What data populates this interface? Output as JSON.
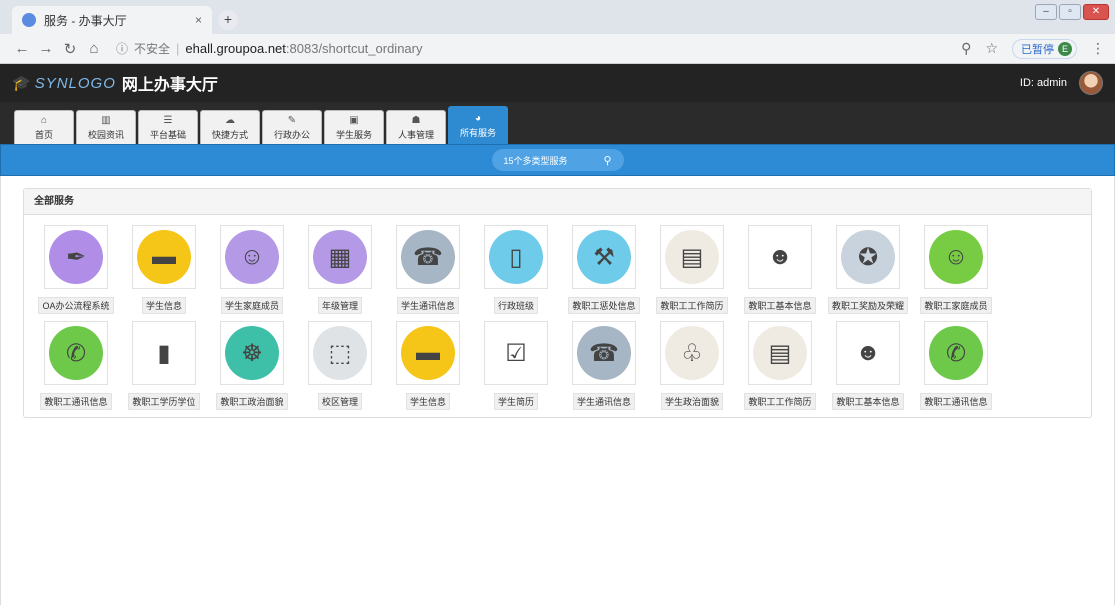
{
  "browser": {
    "tab_title": "服务 - 办事大厅",
    "tab_close": "×",
    "new_tab": "+",
    "insecure": "不安全",
    "url_host": "ehall.groupoa.net",
    "url_path": ":8083/shortcut_ordinary",
    "paused": "已暂停",
    "profile_initial": "E"
  },
  "header": {
    "logo_text": "SYNLOGO",
    "title": "网上办事大厅",
    "user": "ID: admin"
  },
  "nav": {
    "tabs": [
      {
        "label": "首页",
        "icon": "home-icon",
        "glyph": "⌂"
      },
      {
        "label": "校园资讯",
        "icon": "chart-icon",
        "glyph": "▥"
      },
      {
        "label": "平台基础",
        "icon": "list-icon",
        "glyph": "☰"
      },
      {
        "label": "快捷方式",
        "icon": "cloud-icon",
        "glyph": "☁"
      },
      {
        "label": "行政办公",
        "icon": "wrench-icon",
        "glyph": "✎"
      },
      {
        "label": "学生服务",
        "icon": "image-icon",
        "glyph": "▣"
      },
      {
        "label": "人事管理",
        "icon": "users-icon",
        "glyph": "☗"
      },
      {
        "label": "所有服务",
        "icon": "dashboard-icon",
        "glyph": "◕"
      }
    ]
  },
  "search": {
    "label": "15个多类型服务"
  },
  "panel": {
    "title": "全部服务"
  },
  "services": [
    {
      "label": "OA办公流程系统",
      "icon": "pen-icon",
      "color": "#b08ee8",
      "glyph": "✒"
    },
    {
      "label": "学生信息",
      "icon": "card-icon",
      "color": "#f5c518",
      "glyph": "▬"
    },
    {
      "label": "学生家庭成员",
      "icon": "astronaut-icon",
      "color": "#b49ae6",
      "glyph": "☺"
    },
    {
      "label": "年级管理",
      "icon": "building-icon",
      "color": "#b49ae6",
      "glyph": "▦"
    },
    {
      "label": "学生通讯信息",
      "icon": "phone-icon",
      "color": "#a6b6c4",
      "glyph": "☎"
    },
    {
      "label": "行政班级",
      "icon": "door-icon",
      "color": "#6fcbea",
      "glyph": "▯"
    },
    {
      "label": "教职工惩处信息",
      "icon": "hammer-icon",
      "color": "#6fcbea",
      "glyph": "⚒"
    },
    {
      "label": "教职工工作简历",
      "icon": "idcard-icon",
      "color": "#efeae2",
      "glyph": "▤"
    },
    {
      "label": "教职工基本信息",
      "icon": "badge-icon",
      "color": "#ffffff",
      "glyph": "☻"
    },
    {
      "label": "教职工奖励及荣耀",
      "icon": "medal-icon",
      "color": "#c9d3dd",
      "glyph": "✪"
    },
    {
      "label": "教职工家庭成员",
      "icon": "baby-icon",
      "color": "#77cc44",
      "glyph": "☺"
    },
    {
      "label": "教职工通讯信息",
      "icon": "call-icon",
      "color": "#6ec94a",
      "glyph": "✆"
    },
    {
      "label": "教职工学历学位",
      "icon": "book-icon",
      "color": "#ffffff",
      "glyph": "▮"
    },
    {
      "label": "教职工政治面貌",
      "icon": "helm-icon",
      "color": "#3dbfa8",
      "glyph": "☸"
    },
    {
      "label": "校区管理",
      "icon": "select-icon",
      "color": "#dfe3e6",
      "glyph": "⬚"
    },
    {
      "label": "学生信息",
      "icon": "card-icon",
      "color": "#f5c518",
      "glyph": "▬"
    },
    {
      "label": "学生简历",
      "icon": "clipboard-icon",
      "color": "#ffffff",
      "glyph": "☑"
    },
    {
      "label": "学生通讯信息",
      "icon": "phone-icon",
      "color": "#a6b6c4",
      "glyph": "☎"
    },
    {
      "label": "学生政治面貌",
      "icon": "mobile-icon",
      "color": "#efeae2",
      "glyph": "♧"
    },
    {
      "label": "教职工工作简历",
      "icon": "idcard-icon",
      "color": "#efeae2",
      "glyph": "▤"
    },
    {
      "label": "教职工基本信息",
      "icon": "badge-icon",
      "color": "#ffffff",
      "glyph": "☻"
    },
    {
      "label": "教职工通讯信息",
      "icon": "call-icon",
      "color": "#6ec94a",
      "glyph": "✆"
    }
  ]
}
